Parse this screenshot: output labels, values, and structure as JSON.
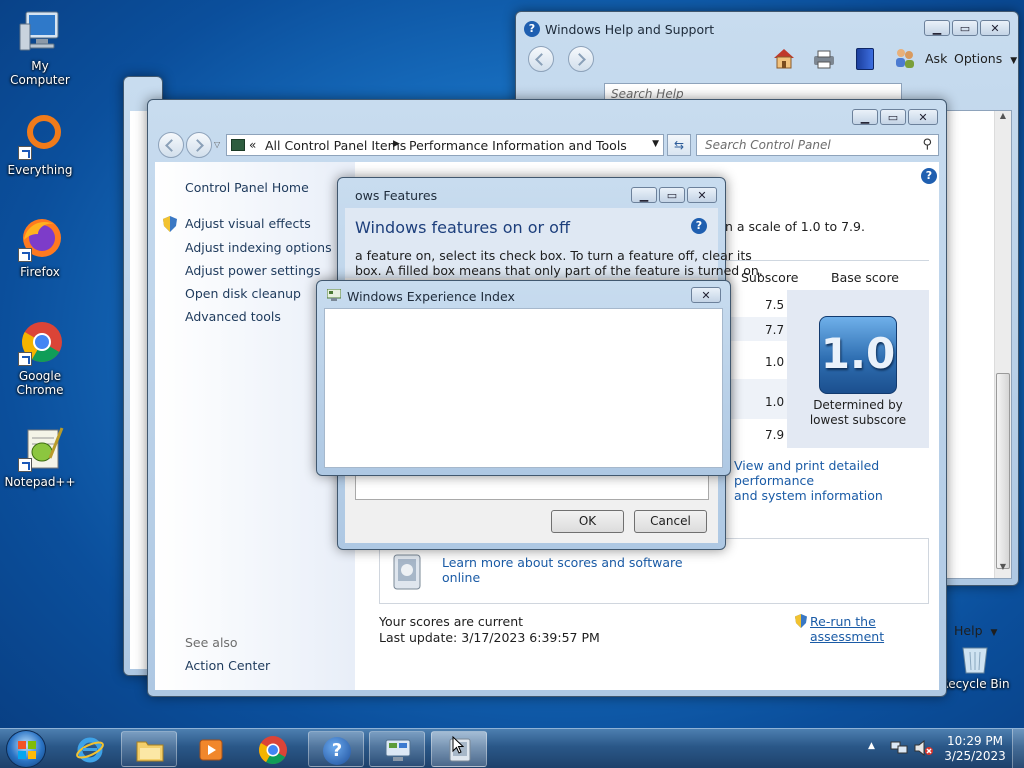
{
  "desktop": {
    "icons": [
      {
        "label": "My Computer",
        "icon": "computer-icon"
      },
      {
        "label": "Everything",
        "icon": "everything-icon"
      },
      {
        "label": "Firefox",
        "icon": "firefox-icon"
      },
      {
        "label": "Google Chrome",
        "label_line1": "Google",
        "label_line2": "Chrome",
        "icon": "chrome-icon"
      },
      {
        "label": "Notepad++",
        "icon": "notepadpp-icon"
      },
      {
        "label": "Recycle Bin",
        "icon": "recycle-bin-icon"
      }
    ]
  },
  "help_window": {
    "title": "Windows Help and Support",
    "search_placeholder": "Search Help",
    "toolbar": {
      "ask": "Ask",
      "options": "Options"
    },
    "footer_help": "Help"
  },
  "cp_window": {
    "breadcrumb": [
      "All Control Panel Items",
      "Performance Information and Tools"
    ],
    "search_placeholder": "Search Control Panel",
    "left_links": [
      "Control Panel Home",
      "Adjust visual effects",
      "Adjust indexing options",
      "Adjust power settings",
      "Open disk cleanup",
      "Advanced tools"
    ],
    "see_also": "See also",
    "action_center": "Action Center",
    "scale_text": "n a scale of 1.0 to 7.9.",
    "table": {
      "subscore_header": "Subscore",
      "base_header": "Base score",
      "subscores": [
        "7.5",
        "7.7",
        "1.0",
        "1.0",
        "7.9"
      ],
      "base_score": "1.0",
      "determined_line1": "Determined by",
      "determined_line2": "lowest subscore"
    },
    "print_link_line1": "View and print detailed performance",
    "print_link_line2": "and system information",
    "learn_link_line1": "Learn more about scores and software",
    "learn_link_line2": "online",
    "scores_current": "Your scores are current",
    "last_update": "Last update: 3/17/2023 6:39:57 PM",
    "rerun": "Re-run the assessment"
  },
  "features_dialog": {
    "title": "ows Features",
    "heading": "Windows features on or off",
    "desc_line1": "a feature on, select its check box. To turn a feature off, clear its",
    "desc_line2": "box. A filled box means that only part of the feature is turned on.",
    "ok": "OK",
    "cancel": "Cancel"
  },
  "experience_dialog": {
    "title": "Windows Experience Index"
  },
  "taskbar": {
    "time": "10:29 PM",
    "date": "3/25/2023"
  },
  "colors": {
    "link": "#1a5ba6",
    "score_tile": "#2f6fb2"
  }
}
